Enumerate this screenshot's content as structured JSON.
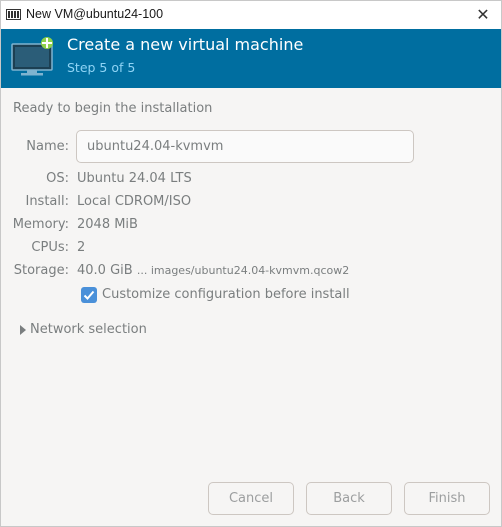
{
  "window": {
    "title": "New VM@ubuntu24-100",
    "close_glyph": "✕"
  },
  "banner": {
    "title": "Create a new virtual machine",
    "step": "Step 5 of 5",
    "background": "#006ea0",
    "step_color": "#8fd4f5"
  },
  "summary": {
    "heading": "Ready to begin the installation",
    "name_label": "Name:",
    "name_value": "ubuntu24.04-kvmvm",
    "os_label": "OS:",
    "os_value": "Ubuntu 24.04 LTS",
    "install_label": "Install:",
    "install_value": "Local CDROM/ISO",
    "memory_label": "Memory:",
    "memory_value": "2048 MiB",
    "cpus_label": "CPUs:",
    "cpus_value": "2",
    "storage_label": "Storage:",
    "storage_size": "40.0 GiB",
    "storage_path": "... images/ubuntu24.04-kvmvm.qcow2"
  },
  "customize": {
    "label": "Customize configuration before install",
    "checked": true
  },
  "network": {
    "label": "Network selection"
  },
  "buttons": {
    "cancel": "Cancel",
    "back": "Back",
    "finish": "Finish"
  }
}
